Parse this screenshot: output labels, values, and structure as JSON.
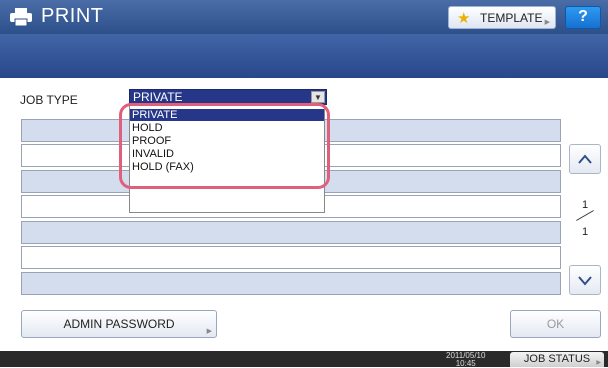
{
  "header": {
    "title": "PRINT",
    "template_label": "TEMPLATE",
    "help_label": "?"
  },
  "job_type": {
    "label": "JOB TYPE",
    "selected": "PRIVATE",
    "options": [
      "PRIVATE",
      "HOLD",
      "PROOF",
      "INVALID",
      "HOLD (FAX)"
    ]
  },
  "pagination": {
    "current": "1",
    "total": "1"
  },
  "footer": {
    "admin_password_label": "ADMIN PASSWORD",
    "ok_label": "OK"
  },
  "statusbar": {
    "date": "2011/05/10",
    "time": "10:45",
    "job_status_label": "JOB STATUS"
  },
  "colors": {
    "header": "#2d4f8a",
    "selected": "#26378a",
    "highlight": "#e0607c",
    "row_alt": "#d3ddee"
  }
}
